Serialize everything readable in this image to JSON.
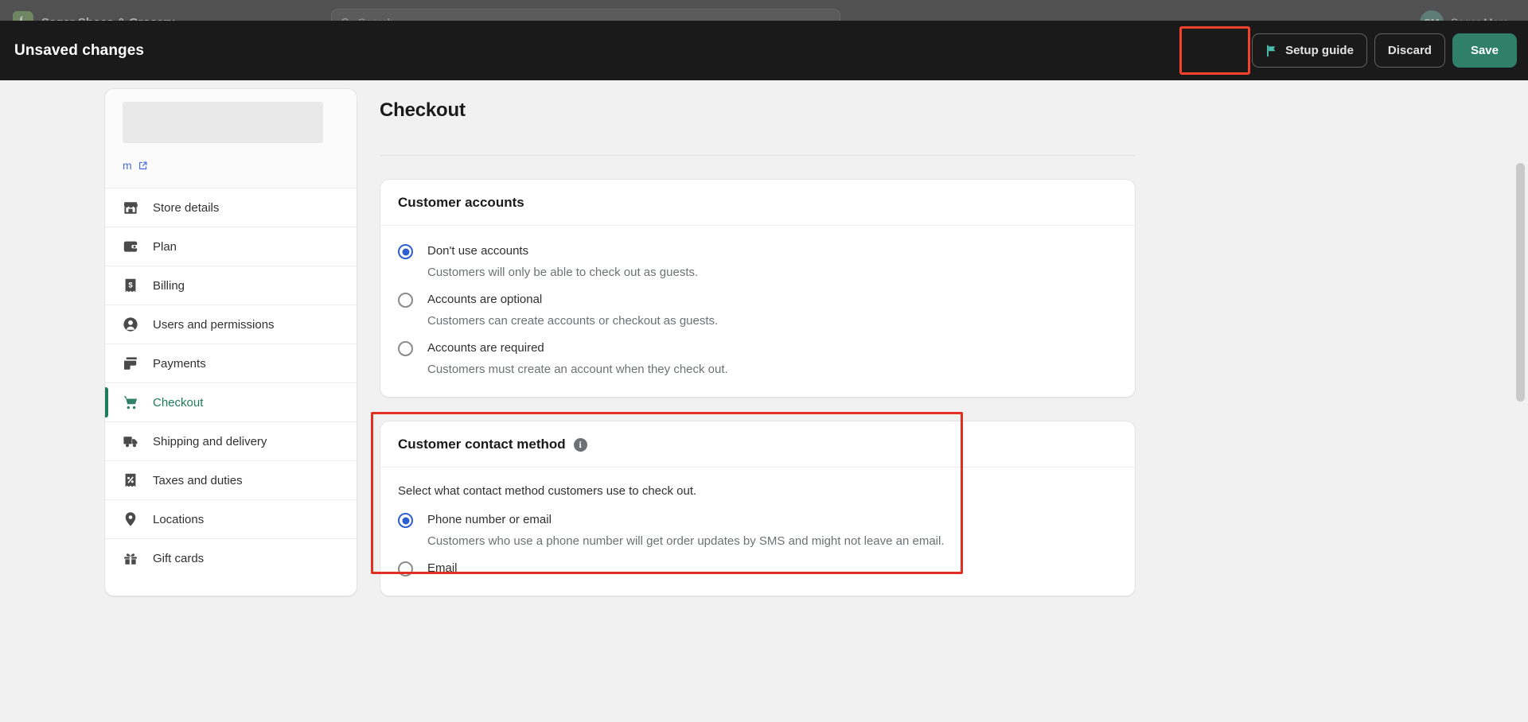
{
  "top_nav": {
    "store_name": "Sagar Shoes & Grocery",
    "search_placeholder": "Search",
    "search_icon": "search-icon",
    "logo_icon": "shopify-logo-icon",
    "user": {
      "initials": "SM",
      "name": "Sagar More"
    }
  },
  "save_bar": {
    "title": "Unsaved changes",
    "setup_guide_label": "Setup guide",
    "setup_guide_icon": "flag-icon",
    "discard_label": "Discard",
    "save_label": "Save",
    "save_accent_color": "#2f8066",
    "highlight_color": "#f5402c"
  },
  "sidebar": {
    "store_url_fragment": "m",
    "external_link_icon": "external-link-icon",
    "items": [
      {
        "label": "Store details",
        "icon": "storefront-icon",
        "active": false
      },
      {
        "label": "Plan",
        "icon": "wallet-icon",
        "active": false
      },
      {
        "label": "Billing",
        "icon": "receipt-dollar-icon",
        "active": false
      },
      {
        "label": "Users and permissions",
        "icon": "person-icon",
        "active": false
      },
      {
        "label": "Payments",
        "icon": "credit-card-icon",
        "active": false
      },
      {
        "label": "Checkout",
        "icon": "shopping-cart-icon",
        "active": true
      },
      {
        "label": "Shipping and delivery",
        "icon": "delivery-truck-icon",
        "active": false
      },
      {
        "label": "Taxes and duties",
        "icon": "receipt-percent-icon",
        "active": false
      },
      {
        "label": "Locations",
        "icon": "map-pin-icon",
        "active": false
      },
      {
        "label": "Gift cards",
        "icon": "gift-card-icon",
        "active": false
      }
    ],
    "active_color": "#1e7a5b"
  },
  "main": {
    "page_title": "Checkout",
    "customer_accounts": {
      "heading": "Customer accounts",
      "options": [
        {
          "label": "Don't use accounts",
          "description": "Customers will only be able to check out as guests.",
          "selected": true
        },
        {
          "label": "Accounts are optional",
          "description": "Customers can create accounts or checkout as guests.",
          "selected": false
        },
        {
          "label": "Accounts are required",
          "description": "Customers must create an account when they check out.",
          "selected": false
        }
      ]
    },
    "customer_contact_method": {
      "heading": "Customer contact method",
      "info_icon": "info-icon",
      "hint": "Select what contact method customers use to check out.",
      "options": [
        {
          "label": "Phone number or email",
          "description": "Customers who use a phone number will get order updates by SMS and might not leave an email.",
          "selected": true
        },
        {
          "label": "Email",
          "description": "",
          "selected": false
        }
      ]
    }
  }
}
